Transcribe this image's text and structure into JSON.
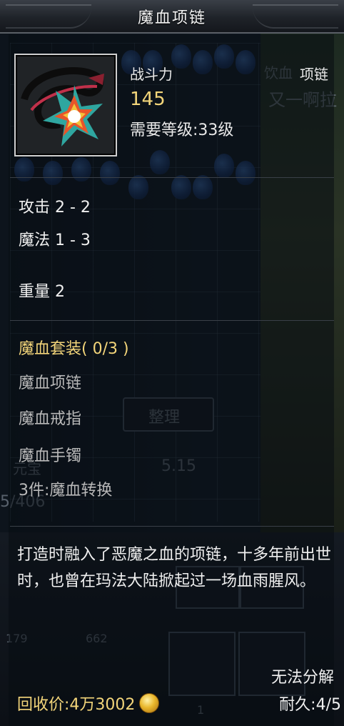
{
  "window": {
    "title": "魔血项链"
  },
  "item": {
    "icon": "star-amulet-icon",
    "power_label": "战斗力",
    "power_value": "145",
    "required_level": "需要等级:33级"
  },
  "stats": [
    {
      "label": "攻击 2 - 2"
    },
    {
      "label": "魔法 1 - 3"
    },
    {
      "label": "重量 2"
    }
  ],
  "set": {
    "title": "魔血套装( 0/3 )",
    "pieces": [
      "魔血项链",
      "魔血戒指",
      "魔血手镯"
    ],
    "bonus": "3件:魔血转换"
  },
  "description": "打造时融入了恶魔之血的项链，十多年前出世时，也曾在玛法大陆掀起过一场血雨腥风。",
  "footer": {
    "dismantle": "无法分解",
    "recycle_price": "回收价:4万3002",
    "currency_icon": "gold-coin-icon",
    "durability": "耐久:4/5"
  },
  "background": {
    "right_label_1": "饮血",
    "right_label_2": "项链",
    "right_label_3": "又一啊拉",
    "sort_button": "整理",
    "yuanbao_label": "元宝",
    "yuanbao_value": "5.15",
    "bag_count": "5/406",
    "hp_value": "179",
    "mp_value": "662",
    "slot_number": "1"
  },
  "colors": {
    "accent_gold": "#f3d57a",
    "text_primary": "#f0f0f0",
    "text_muted": "#b9b9b9"
  }
}
